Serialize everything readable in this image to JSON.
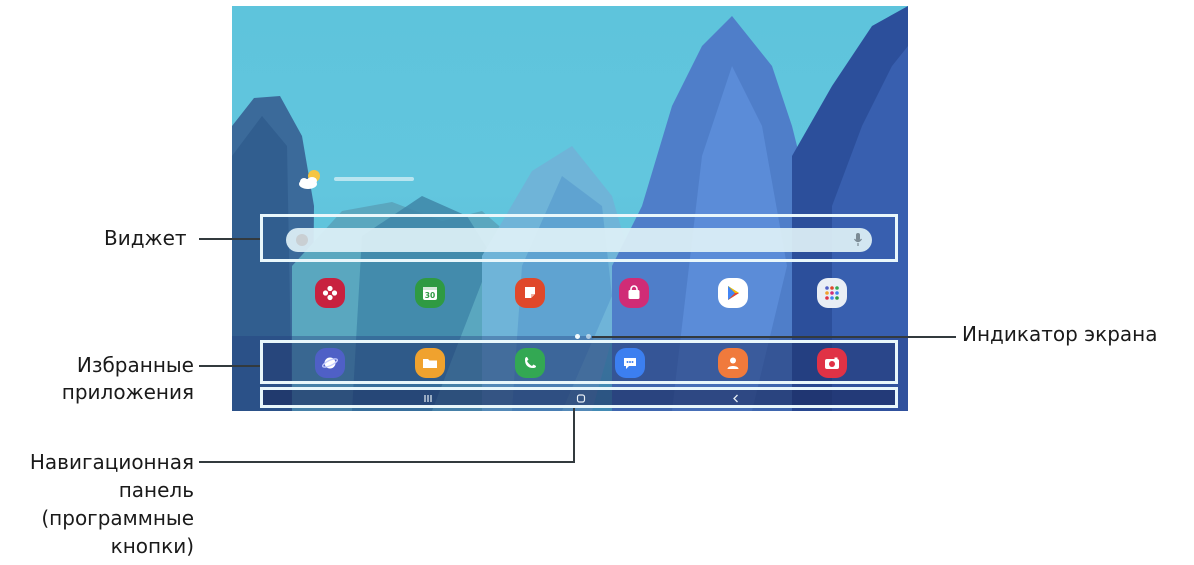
{
  "labels": {
    "widget": "Виджет",
    "favorites_line1": "Избранные",
    "favorites_line2": "приложения",
    "screen_indicator": "Индикатор экрана",
    "nav_line1": "Навигационная",
    "nav_line2": "панель",
    "nav_line3": "(программные",
    "nav_line4": "кнопки)"
  },
  "home_apps": [
    {
      "icon": "flower-icon",
      "color": "#c8213f"
    },
    {
      "icon": "calendar-icon",
      "color": "#2f9a43",
      "text": "30"
    },
    {
      "icon": "notes-icon",
      "color": "#e0482b"
    },
    {
      "icon": "shopping-bag-icon",
      "color": "#d02c76"
    },
    {
      "icon": "play-store-icon",
      "color": "#ffffff"
    },
    {
      "icon": "app-folder-icon",
      "color": "#e9eef5"
    }
  ],
  "favorite_apps": [
    {
      "icon": "planet-icon",
      "color": "#4f60c6"
    },
    {
      "icon": "folder-icon",
      "color": "#f0a22e"
    },
    {
      "icon": "phone-icon",
      "color": "#33a853"
    },
    {
      "icon": "message-icon",
      "color": "#3c7ff0"
    },
    {
      "icon": "contact-icon",
      "color": "#f07a3c"
    },
    {
      "icon": "camera-icon",
      "color": "#e03246"
    }
  ],
  "nav_buttons": [
    "recents-icon",
    "home-icon",
    "back-icon"
  ],
  "page_indicator": {
    "pages": 2,
    "current": 1
  }
}
